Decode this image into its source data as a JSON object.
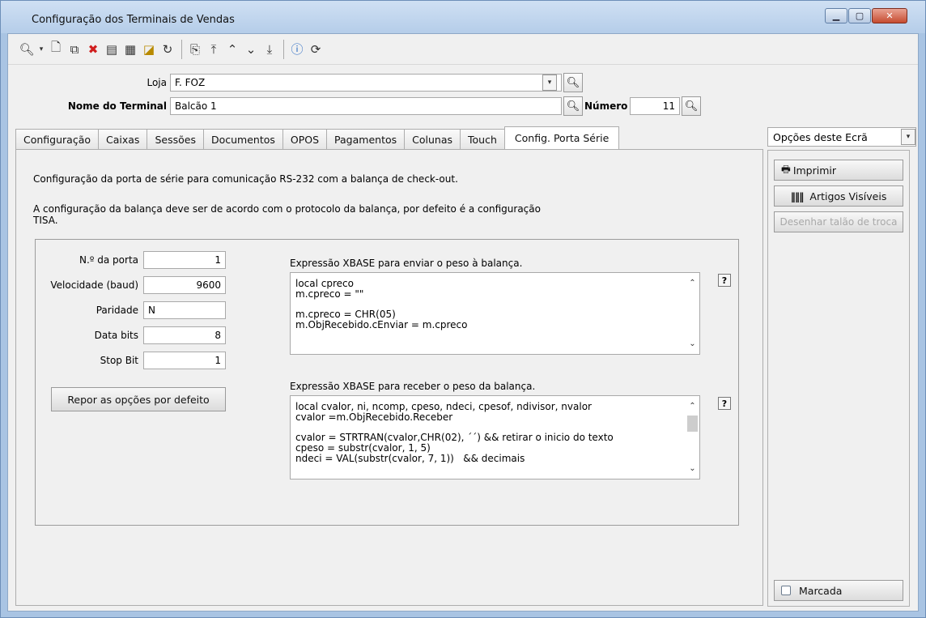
{
  "window": {
    "title": "Configuração dos Terminais de Vendas"
  },
  "toolbar": {
    "icons": [
      "search-icon",
      "dropdown-icon",
      "new-icon",
      "copy-icon",
      "delete-icon",
      "form-icon",
      "grid-icon",
      "filter-icon",
      "refresh-icon",
      "preview-icon",
      "first-icon",
      "prev-icon",
      "next-icon",
      "last-icon",
      "help-icon",
      "reload-icon"
    ]
  },
  "header": {
    "loja_label": "Loja",
    "loja_value": "F. FOZ",
    "terminal_label": "Nome do Terminal",
    "terminal_value": "Balcão 1",
    "numero_label": "Número",
    "numero_value": "11"
  },
  "tabs": [
    {
      "label": "Configuração"
    },
    {
      "label": "Caixas"
    },
    {
      "label": "Sessões"
    },
    {
      "label": "Documentos"
    },
    {
      "label": "OPOS"
    },
    {
      "label": "Pagamentos"
    },
    {
      "label": "Colunas"
    },
    {
      "label": "Touch"
    },
    {
      "label": "Config. Porta Série"
    }
  ],
  "panel": {
    "intro1": "Configuração da porta de série para comunicação RS-232 com a balança de check-out.",
    "intro2_line1": "A configuração da balança deve ser de acordo com o protocolo da balança, por defeito é a configuração",
    "intro2_line2": "TISA.",
    "fields": {
      "porta_label": "N.º da porta",
      "porta_value": "1",
      "velocidade_label": "Velocidade (baud)",
      "velocidade_value": "9600",
      "paridade_label": "Paridade",
      "paridade_value": "N",
      "databits_label": "Data bits",
      "databits_value": "8",
      "stopbit_label": "Stop Bit",
      "stopbit_value": "1"
    },
    "reset_button": "Repor as opções por defeito",
    "send_label": "Expressão XBASE para enviar o peso à balança.",
    "send_code": "local cpreco\nm.cpreco = \"\"\n\nm.cpreco = CHR(05)\nm.ObjRecebido.cEnviar = m.cpreco",
    "recv_label": "Expressão XBASE para receber o peso da balança.",
    "recv_code": "local cvalor, ni, ncomp, cpeso, ndeci, cpesof, ndivisor, nvalor\ncvalor =m.ObjRecebido.Receber\n\ncvalor = STRTRAN(cvalor,CHR(02), ´´) && retirar o inicio do texto\ncpeso = substr(cvalor, 1, 5)\nndeci = VAL(substr(cvalor, 7, 1))   && decimais",
    "help_mark": "?"
  },
  "side": {
    "combo": "Opções deste Ecrã",
    "imprimir": "Imprimir",
    "artigos": "Artigos Visíveis",
    "desenhar": "Desenhar talão de troca",
    "marcada": "Marcada"
  }
}
